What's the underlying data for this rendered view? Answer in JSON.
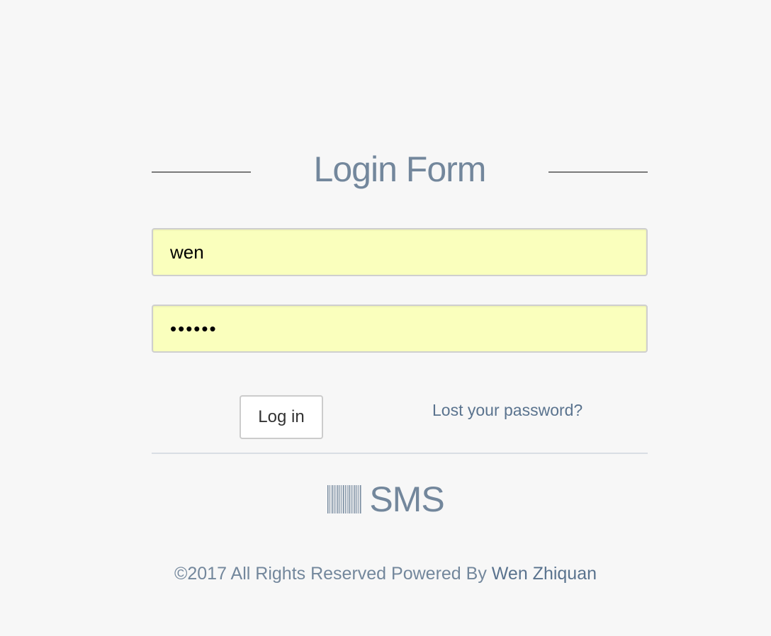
{
  "login": {
    "title": "Login Form",
    "username_value": "wen",
    "password_value": "••••••",
    "login_button": "Log in",
    "lost_password_link": "Lost your password?"
  },
  "brand": {
    "icon": "barcode-icon",
    "name": "SMS"
  },
  "footer": {
    "text": "©2017 All Rights Reserved Powered By ",
    "author": "Wen Zhiquan"
  },
  "colors": {
    "background": "#f7f7f7",
    "accent_text": "#73879c",
    "link": "#5a738e",
    "autofill_field": "#faffbd"
  }
}
